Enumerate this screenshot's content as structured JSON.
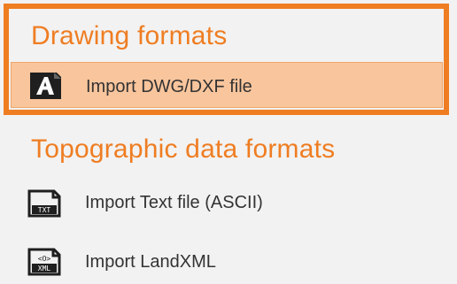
{
  "sections": [
    {
      "title": "Drawing formats",
      "items": [
        {
          "label": "Import DWG/DXF file",
          "icon": "dwg-dxf-icon",
          "selected": true
        }
      ]
    },
    {
      "title": "Topographic data formats",
      "items": [
        {
          "label": "Import Text file (ASCII)",
          "icon": "txt-file-icon",
          "icon_text": "TXT"
        },
        {
          "label": "Import LandXML",
          "icon": "xml-file-icon",
          "icon_text_top": "<O>",
          "icon_text_bottom": "XML"
        }
      ]
    }
  ],
  "colors": {
    "accent": "#ef7d22",
    "selected_background": "#f9c59c",
    "selected_border": "#efa66b",
    "menu_background": "#f2f2f2",
    "text": "#333333"
  }
}
